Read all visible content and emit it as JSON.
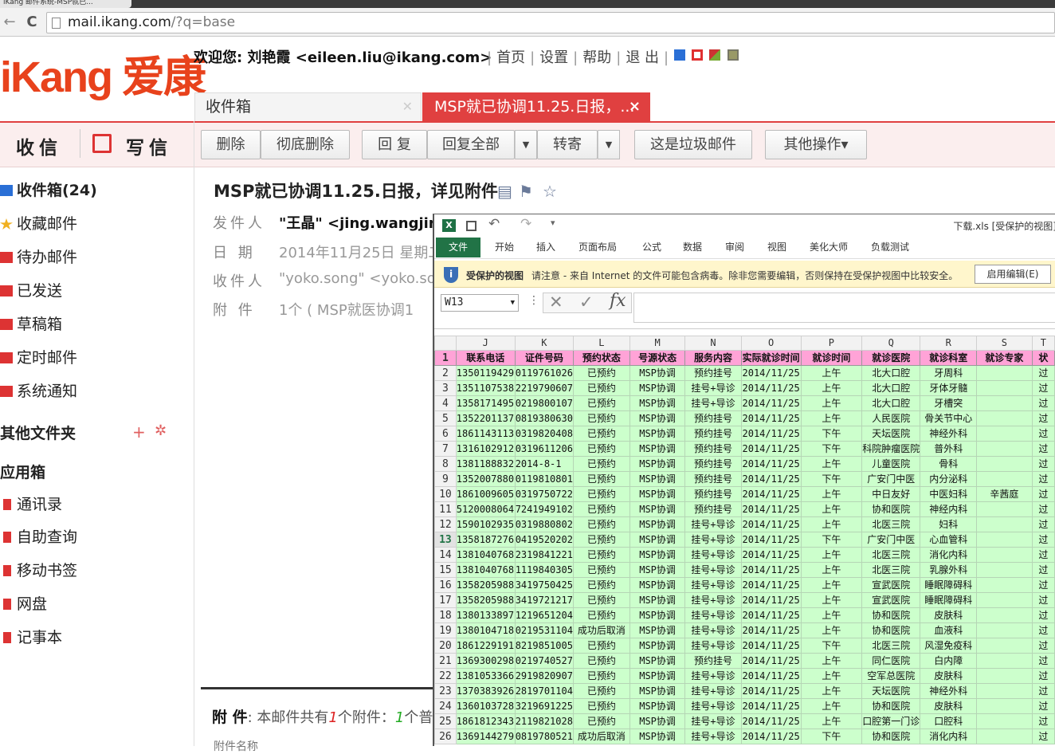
{
  "browser": {
    "tab_title": "iKang 邮件系统-MSP就已...",
    "tab_close": "×",
    "back": "←",
    "forward": "→",
    "reload": "C",
    "url_host": "mail.ikang.com",
    "url_path": "/?q=base"
  },
  "header": {
    "logo_text": "iKang 爱康",
    "welcome": "欢迎您: 刘艳霞 <eileen.liu@ikang.com>",
    "links": [
      "首页",
      "设置",
      "帮助",
      "退 出"
    ],
    "skin_colors": [
      "#2a6fd6",
      "#e03030",
      "#cc3333",
      "#999966"
    ]
  },
  "tabs": {
    "inbox_label": "收件箱",
    "inbox_close": "✕",
    "active_label": "MSP就已协调11.25.日报，...",
    "active_close": "×"
  },
  "actions": {
    "receive": "收信",
    "compose": "写信"
  },
  "toolbar": {
    "delete": "删除",
    "purge": "彻底删除",
    "reply": "回 复",
    "reply_all": "回复全部",
    "forward": "转寄",
    "spam": "这是垃圾邮件",
    "more": "其他操作▾",
    "caret": "▼"
  },
  "sidebar": {
    "items": [
      {
        "label": "收件箱(24)",
        "color": "#2a6fd6"
      },
      {
        "label": "收藏邮件",
        "color": "#f0b020"
      },
      {
        "label": "待办邮件",
        "color": "#d33"
      },
      {
        "label": "已发送",
        "color": "#d33"
      },
      {
        "label": "草稿箱",
        "color": "#d33"
      },
      {
        "label": "定时邮件",
        "color": "#d33"
      },
      {
        "label": "系统通知",
        "color": "#d33"
      }
    ],
    "other_folders": "其他文件夹",
    "plus": "+",
    "gear": "✲",
    "apps_title": "应用箱",
    "apps": [
      "通讯录",
      "自助查询",
      "移动书签",
      "网盘",
      "记事本"
    ]
  },
  "mail": {
    "subject": "MSP就已协调11.25.日报，详见附件",
    "from_label": "发件人",
    "from_value": "\"王晶\" <jing.wangjing",
    "date_label": "日  期",
    "date_value": "2014年11月25日 星期二",
    "to_label": "收件人",
    "to_value": "\"yoko.song\" <yoko.son",
    "attach_label": "附  件",
    "attach_value": "1个 ( MSP就医协调1",
    "footer_title": "附  件",
    "footer_text_a": ": 本邮件共有",
    "footer_count": "1",
    "footer_text_b": "个附件：",
    "footer_count2": "1",
    "footer_text_c": "个普",
    "footer_sub": "附件名称"
  },
  "excel": {
    "filename": "下载.xls  [受保护的视图]",
    "logo": "X",
    "ribbon_tabs": [
      "文件",
      "开始",
      "插入",
      "页面布局",
      "公式",
      "数据",
      "审阅",
      "视图",
      "美化大师",
      "负载测试"
    ],
    "protect_title": "受保护的视图",
    "protect_msg": "请注意 - 来自 Internet 的文件可能包含病毒。除非您需要编辑，否则保持在受保护视图中比较安全。",
    "enable_edit": "启用编辑(E)",
    "name_box": "W13",
    "fx": "fx"
  },
  "sheet": {
    "columns": [
      "J",
      "K",
      "L",
      "M",
      "N",
      "O",
      "P",
      "Q",
      "R",
      "S",
      "T"
    ],
    "headers": [
      "联系电话",
      "证件号码",
      "预约状态",
      "号源状态",
      "服务内容",
      "实际就诊时间",
      "就诊时间",
      "就诊医院",
      "就诊科室",
      "就诊专家",
      "状"
    ],
    "selected_row": 13,
    "rows": [
      {
        "n": 2,
        "c": [
          "1350119429",
          "0119761026",
          "已预约",
          "MSP协调",
          "预约挂号",
          "2014/11/25",
          "上午",
          "北大口腔",
          "牙周科",
          "",
          "过"
        ]
      },
      {
        "n": 3,
        "c": [
          "1351107538",
          "2219790607",
          "已预约",
          "MSP协调",
          "挂号+导诊",
          "2014/11/25",
          "上午",
          "北大口腔",
          "牙体牙髓",
          "",
          "过"
        ]
      },
      {
        "n": 4,
        "c": [
          "1358171495",
          "0219800107",
          "已预约",
          "MSP协调",
          "挂号+导诊",
          "2014/11/25",
          "上午",
          "北大口腔",
          "牙槽突",
          "",
          "过"
        ]
      },
      {
        "n": 5,
        "c": [
          "1352201137",
          "0819380630",
          "已预约",
          "MSP协调",
          "预约挂号",
          "2014/11/25",
          "上午",
          "人民医院",
          "骨关节中心",
          "",
          "过"
        ]
      },
      {
        "n": 6,
        "c": [
          "1861143113",
          "0319820408",
          "已预约",
          "MSP协调",
          "预约挂号",
          "2014/11/25",
          "下午",
          "天坛医院",
          "神经外科",
          "",
          "过"
        ]
      },
      {
        "n": 7,
        "c": [
          "1316102912",
          "0319611206",
          "已预约",
          "MSP协调",
          "预约挂号",
          "2014/11/25",
          "下午",
          "科院肿瘤医院",
          "普外科",
          "",
          "过"
        ]
      },
      {
        "n": 8,
        "c": [
          "1381188832",
          "2014-8-1",
          "已预约",
          "MSP协调",
          "预约挂号",
          "2014/11/25",
          "上午",
          "儿童医院",
          "骨科",
          "",
          "过"
        ]
      },
      {
        "n": 9,
        "c": [
          "1352007880",
          "0119810801",
          "已预约",
          "MSP协调",
          "预约挂号",
          "2014/11/25",
          "下午",
          "广安门中医",
          "内分泌科",
          "",
          "过"
        ]
      },
      {
        "n": 10,
        "c": [
          "1861009605",
          "0319750722",
          "已预约",
          "MSP协调",
          "预约挂号",
          "2014/11/25",
          "上午",
          "中日友好",
          "中医妇科",
          "辛茜庭",
          "过"
        ]
      },
      {
        "n": 11,
        "c": [
          "5120008064",
          "7241949102",
          "已预约",
          "MSP协调",
          "预约挂号",
          "2014/11/25",
          "上午",
          "协和医院",
          "神经内科",
          "",
          "过"
        ]
      },
      {
        "n": 12,
        "c": [
          "1590102935",
          "0319880802",
          "已预约",
          "MSP协调",
          "挂号+导诊",
          "2014/11/25",
          "上午",
          "北医三院",
          "妇科",
          "",
          "过"
        ]
      },
      {
        "n": 13,
        "c": [
          "1358187276",
          "0419520202",
          "已预约",
          "MSP协调",
          "挂号+导诊",
          "2014/11/25",
          "下午",
          "广安门中医",
          "心血管科",
          "",
          "过"
        ]
      },
      {
        "n": 14,
        "c": [
          "1381040768",
          "2319841221",
          "已预约",
          "MSP协调",
          "挂号+导诊",
          "2014/11/25",
          "上午",
          "北医三院",
          "消化内科",
          "",
          "过"
        ]
      },
      {
        "n": 15,
        "c": [
          "1381040768",
          "1119840305",
          "已预约",
          "MSP协调",
          "挂号+导诊",
          "2014/11/25",
          "上午",
          "北医三院",
          "乳腺外科",
          "",
          "过"
        ]
      },
      {
        "n": 16,
        "c": [
          "1358205988",
          "3419750425",
          "已预约",
          "MSP协调",
          "挂号+导诊",
          "2014/11/25",
          "上午",
          "宣武医院",
          "睡眠障碍科",
          "",
          "过"
        ]
      },
      {
        "n": 17,
        "c": [
          "1358205988",
          "3419721217",
          "已预约",
          "MSP协调",
          "挂号+导诊",
          "2014/11/25",
          "上午",
          "宣武医院",
          "睡眠障碍科",
          "",
          "过"
        ]
      },
      {
        "n": 18,
        "c": [
          "1380133897",
          "1219651204",
          "已预约",
          "MSP协调",
          "挂号+导诊",
          "2014/11/25",
          "上午",
          "协和医院",
          "皮肤科",
          "",
          "过"
        ]
      },
      {
        "n": 19,
        "c": [
          "1380104718",
          "0219531104",
          "成功后取消",
          "MSP协调",
          "挂号+导诊",
          "2014/11/25",
          "上午",
          "协和医院",
          "血液科",
          "",
          "过"
        ]
      },
      {
        "n": 20,
        "c": [
          "1861229191",
          "8219851005",
          "已预约",
          "MSP协调",
          "挂号+导诊",
          "2014/11/25",
          "下午",
          "北医三院",
          "风湿免疫科",
          "",
          "过"
        ]
      },
      {
        "n": 21,
        "c": [
          "1369300298",
          "0219740527",
          "已预约",
          "MSP协调",
          "预约挂号",
          "2014/11/25",
          "上午",
          "同仁医院",
          "白内障",
          "",
          "过"
        ]
      },
      {
        "n": 22,
        "c": [
          "1381053366",
          "2919820907",
          "已预约",
          "MSP协调",
          "挂号+导诊",
          "2014/11/25",
          "上午",
          "空军总医院",
          "皮肤科",
          "",
          "过"
        ]
      },
      {
        "n": 23,
        "c": [
          "1370383926",
          "2819701104",
          "已预约",
          "MSP协调",
          "挂号+导诊",
          "2014/11/25",
          "上午",
          "天坛医院",
          "神经外科",
          "",
          "过"
        ]
      },
      {
        "n": 24,
        "c": [
          "1360103728",
          "3219691225",
          "已预约",
          "MSP协调",
          "挂号+导诊",
          "2014/11/25",
          "上午",
          "协和医院",
          "皮肤科",
          "",
          "过"
        ]
      },
      {
        "n": 25,
        "c": [
          "1861812343",
          "2119821028",
          "已预约",
          "MSP协调",
          "挂号+导诊",
          "2014/11/25",
          "上午",
          "口腔第一门诊",
          "口腔科",
          "",
          "过"
        ]
      },
      {
        "n": 26,
        "c": [
          "1369144279",
          "0819780521",
          "成功后取消",
          "MSP协调",
          "挂号+导诊",
          "2014/11/25",
          "下午",
          "协和医院",
          "消化内科",
          "",
          "过"
        ]
      }
    ]
  }
}
